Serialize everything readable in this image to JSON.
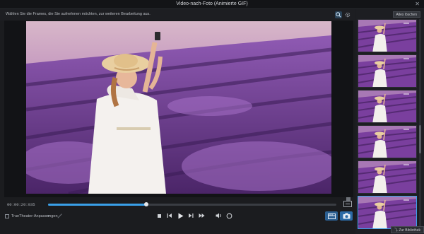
{
  "window": {
    "title": "Video-nach-Foto (Animierte GIF)"
  },
  "toolbar": {
    "hint": "Wählen Sie die Frames, die Sie aufnehmen möchten, zur weiteren Bearbeitung aus."
  },
  "playback": {
    "timecode": "00:00:20:035",
    "progress": 0.34
  },
  "controls": {
    "checkbox_label": "TrueTheater-Anpassungen"
  },
  "sidebar": {
    "deselect_all": "Alles löschen",
    "thumbnail_count": 6,
    "selected_index": 5
  },
  "footer": {
    "library_button": "Zur Bibliothek"
  },
  "icons": [
    "close-icon",
    "zoom-icon",
    "gear-icon",
    "stop-icon",
    "prev-frame-icon",
    "play-icon",
    "next-frame-icon",
    "fast-forward-icon",
    "volume-icon",
    "rotate-icon",
    "film-icon",
    "camera-icon"
  ],
  "colors": {
    "accent": "#3aa0e8",
    "button_blue": "#2b6aa6",
    "lavender": "#7a3f9e"
  }
}
